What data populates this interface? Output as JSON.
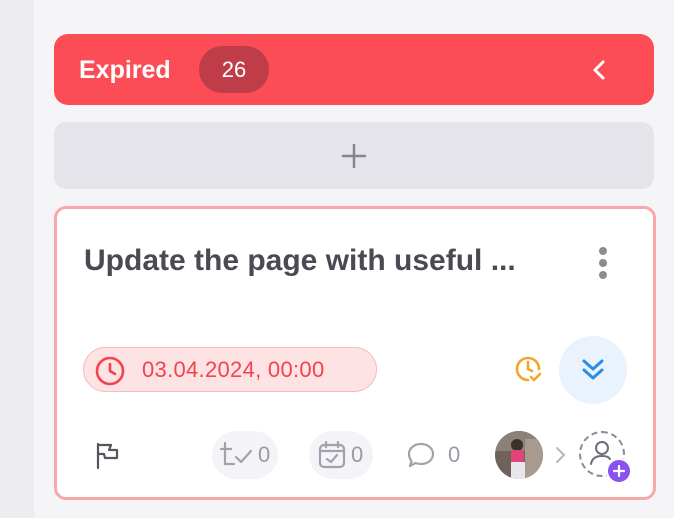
{
  "column": {
    "title": "Expired",
    "count": "26",
    "header_color": "#fc4c55",
    "collapse_icon": "chevron-left-icon",
    "add_icon": "plus-icon"
  },
  "card": {
    "title": "Update the page with useful ...",
    "due_date": "03.04.2024, 00:00",
    "due_color": "#f2434f",
    "checklist_count": "0",
    "subtasks_count": "0",
    "comments_count": "0",
    "icons": [
      "more-vertical-icon",
      "clock-icon",
      "time-tracking-icon",
      "double-chevron-down-icon",
      "flag-icon",
      "checklist-icon",
      "calendar-check-icon",
      "comment-icon",
      "avatar",
      "chevron-right-icon",
      "add-user-icon"
    ]
  }
}
